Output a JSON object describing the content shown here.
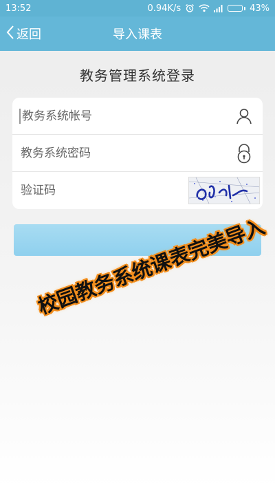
{
  "status_bar": {
    "time": "13:52",
    "network_speed": "0.94K/s",
    "battery_percent": "43%",
    "battery_level": 0.43
  },
  "nav": {
    "back_label": "返回",
    "title": "导入课表"
  },
  "login": {
    "title": "教务管理系统登录",
    "account_placeholder": "教务系统帐号",
    "password_placeholder": "教务系统密码",
    "captcha_placeholder": "验证码"
  },
  "promo": {
    "text": "校园教务系统课表完美导入"
  },
  "colors": {
    "accent": "#64b7d8",
    "status_bar": "#5fb3d3",
    "login_button": "#9ad5ef",
    "promo_stroke": "#f28d1c"
  },
  "icons": {
    "back": "chevron-left-icon",
    "alarm": "alarm-icon",
    "wifi": "wifi-icon",
    "signal": "signal-icon",
    "battery": "battery-icon",
    "account": "user-icon",
    "password": "lock-icon"
  }
}
